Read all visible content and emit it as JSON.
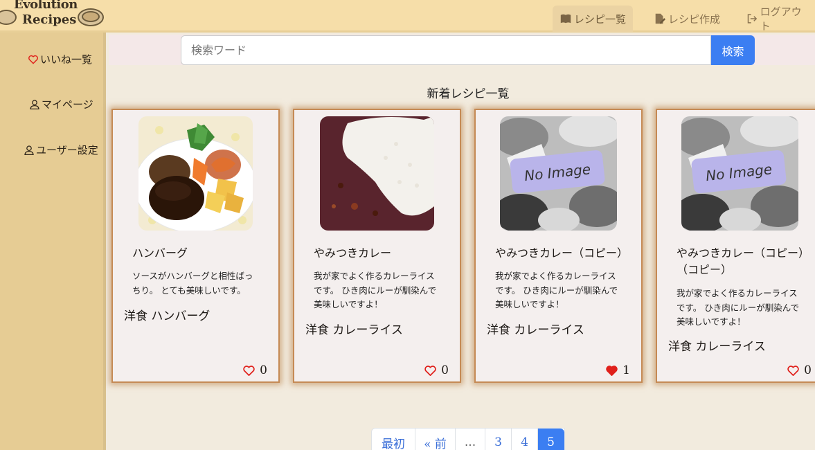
{
  "header": {
    "logo_line1": "Evolution",
    "logo_line2": "Recipes",
    "nav": [
      {
        "label": "レシピ一覧",
        "icon": "book-icon",
        "active": true
      },
      {
        "label": "レシピ作成",
        "icon": "edit-document-icon",
        "active": false
      },
      {
        "label": "ログアウト",
        "icon": "logout-icon",
        "active": false
      }
    ]
  },
  "sidebar": {
    "items": [
      {
        "label": "いいね一覧",
        "icon": "heart-icon"
      },
      {
        "label": "マイページ",
        "icon": "user-icon"
      },
      {
        "label": "ユーザー設定",
        "icon": "user-icon"
      }
    ]
  },
  "search": {
    "placeholder": "検索ワード",
    "button_label": "検索"
  },
  "main": {
    "section_title": "新着レシピ一覧"
  },
  "cards": [
    {
      "title": "ハンバーグ",
      "description": "ソースがハンバーグと相性ばっちり。 とても美味しいです。",
      "categories": "洋食 ハンバーグ",
      "likes": "0",
      "liked": false,
      "image": "hamburger-steak-photo"
    },
    {
      "title": "やみつきカレー",
      "description": "我が家でよく作るカレーライスです。 ひき肉にルーが馴染んで美味しいですよ！",
      "categories": "洋食 カレーライス",
      "likes": "0",
      "liked": false,
      "image": "curry-rice-photo"
    },
    {
      "title": "やみつきカレー（コピー）",
      "description": "我が家でよく作るカレーライスです。 ひき肉にルーが馴染んで美味しいですよ！",
      "categories": "洋食 カレーライス",
      "likes": "1",
      "liked": true,
      "image": "no-image-placeholder",
      "no_image_text": "No Image"
    },
    {
      "title": "やみつきカレー（コピー）（コピー）",
      "description": "我が家でよく作るカレーライスです。 ひき肉にルーが馴染んで美味しいですよ！",
      "categories": "洋食 カレーライス",
      "likes": "0",
      "liked": false,
      "image": "no-image-placeholder",
      "no_image_text": "No Image"
    }
  ],
  "pagination": {
    "first": "最初",
    "prev": "« 前",
    "dots": "...",
    "pages": [
      "3",
      "4",
      "5"
    ],
    "current": "5"
  },
  "colors": {
    "header_bg": "#f6dea9",
    "sidebar_bg": "#e6cc94",
    "accent": "#3b7ef2",
    "like_red": "#e0201b"
  }
}
